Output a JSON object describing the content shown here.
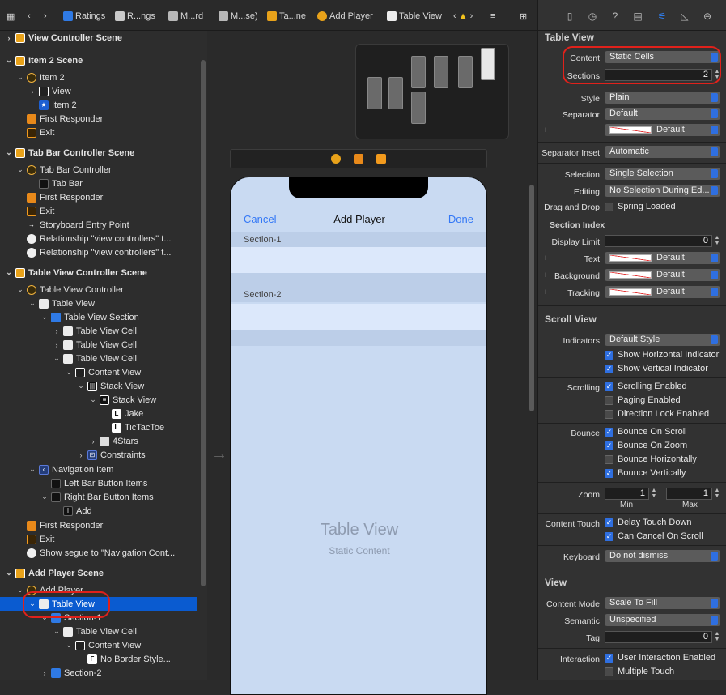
{
  "jumpbar": {
    "items": [
      "Ratings",
      "R...ngs",
      "M...rd",
      "M...se)",
      "Ta...ne",
      "Add Player",
      "Table View"
    ]
  },
  "outline": {
    "rows": [
      {
        "label": "View Controller Scene"
      },
      {
        "label": "Item 2 Scene"
      },
      {
        "label": "Item 2"
      },
      {
        "label": "View"
      },
      {
        "label": "Item 2"
      },
      {
        "label": "First Responder"
      },
      {
        "label": "Exit"
      },
      {
        "label": "Tab Bar Controller Scene"
      },
      {
        "label": "Tab Bar Controller"
      },
      {
        "label": "Tab Bar"
      },
      {
        "label": "First Responder"
      },
      {
        "label": "Exit"
      },
      {
        "label": "Storyboard Entry Point"
      },
      {
        "label": "Relationship \"view controllers\" t..."
      },
      {
        "label": "Relationship \"view controllers\" t..."
      },
      {
        "label": "Table View Controller Scene"
      },
      {
        "label": "Table View Controller"
      },
      {
        "label": "Table View"
      },
      {
        "label": "Table View Section"
      },
      {
        "label": "Table View Cell"
      },
      {
        "label": "Table View Cell"
      },
      {
        "label": "Table View Cell"
      },
      {
        "label": "Content View"
      },
      {
        "label": "Stack View"
      },
      {
        "label": "Stack View"
      },
      {
        "label": "Jake"
      },
      {
        "label": "TicTacToe"
      },
      {
        "label": "4Stars"
      },
      {
        "label": "Constraints"
      },
      {
        "label": "Navigation Item"
      },
      {
        "label": "Left Bar Button Items"
      },
      {
        "label": "Right Bar Button Items"
      },
      {
        "label": "Add"
      },
      {
        "label": "First Responder"
      },
      {
        "label": "Exit"
      },
      {
        "label": "Show segue to \"Navigation Cont..."
      },
      {
        "label": "Add Player Scene"
      },
      {
        "label": "Add Player"
      },
      {
        "label": "Table View"
      },
      {
        "label": "Section-1"
      },
      {
        "label": "Table View Cell"
      },
      {
        "label": "Content View"
      },
      {
        "label": "No Border Style..."
      },
      {
        "label": "Section-2"
      }
    ]
  },
  "canvas": {
    "cancel": "Cancel",
    "title": "Add Player",
    "done": "Done",
    "section1": "Section-1",
    "section2": "Section-2",
    "placeholder_title": "Table View",
    "placeholder_sub": "Static Content"
  },
  "inspector": {
    "table_view_header": "Table View",
    "content_label": "Content",
    "content_value": "Static Cells",
    "sections_label": "Sections",
    "sections_value": "2",
    "style_label": "Style",
    "style_value": "Plain",
    "separator_label": "Separator",
    "separator_value": "Default",
    "separator_color": "Default",
    "separator_inset_label": "Separator Inset",
    "separator_inset_value": "Automatic",
    "selection_label": "Selection",
    "selection_value": "Single Selection",
    "editing_label": "Editing",
    "editing_value": "No Selection During Ed...",
    "drag_drop_label": "Drag and Drop",
    "spring_loaded": "Spring Loaded",
    "section_index_header": "Section Index",
    "display_limit_label": "Display Limit",
    "display_limit_value": "0",
    "text_label": "Text",
    "text_value": "Default",
    "background_label": "Background",
    "background_value": "Default",
    "tracking_label": "Tracking",
    "tracking_value": "Default",
    "scroll_view_header": "Scroll View",
    "indicators_label": "Indicators",
    "indicators_value": "Default Style",
    "show_h_ind": "Show Horizontal Indicator",
    "show_v_ind": "Show Vertical Indicator",
    "scrolling_label": "Scrolling",
    "scrolling_enabled": "Scrolling Enabled",
    "paging_enabled": "Paging Enabled",
    "direction_lock": "Direction Lock Enabled",
    "bounce_label": "Bounce",
    "bounce_on_scroll": "Bounce On Scroll",
    "bounce_on_zoom": "Bounce On Zoom",
    "bounce_h": "Bounce Horizontally",
    "bounce_v": "Bounce Vertically",
    "zoom_label": "Zoom",
    "zoom_min": "1",
    "zoom_max": "1",
    "min_label": "Min",
    "max_label": "Max",
    "content_touch_label": "Content Touch",
    "delay_touch": "Delay Touch Down",
    "can_cancel": "Can Cancel On Scroll",
    "keyboard_label": "Keyboard",
    "keyboard_value": "Do not dismiss",
    "view_header": "View",
    "content_mode_label": "Content Mode",
    "content_mode_value": "Scale To Fill",
    "semantic_label": "Semantic",
    "semantic_value": "Unspecified",
    "tag_label": "Tag",
    "tag_value": "0",
    "interaction_label": "Interaction",
    "user_interaction": "User Interaction Enabled",
    "multiple_touch": "Multiple Touch"
  }
}
